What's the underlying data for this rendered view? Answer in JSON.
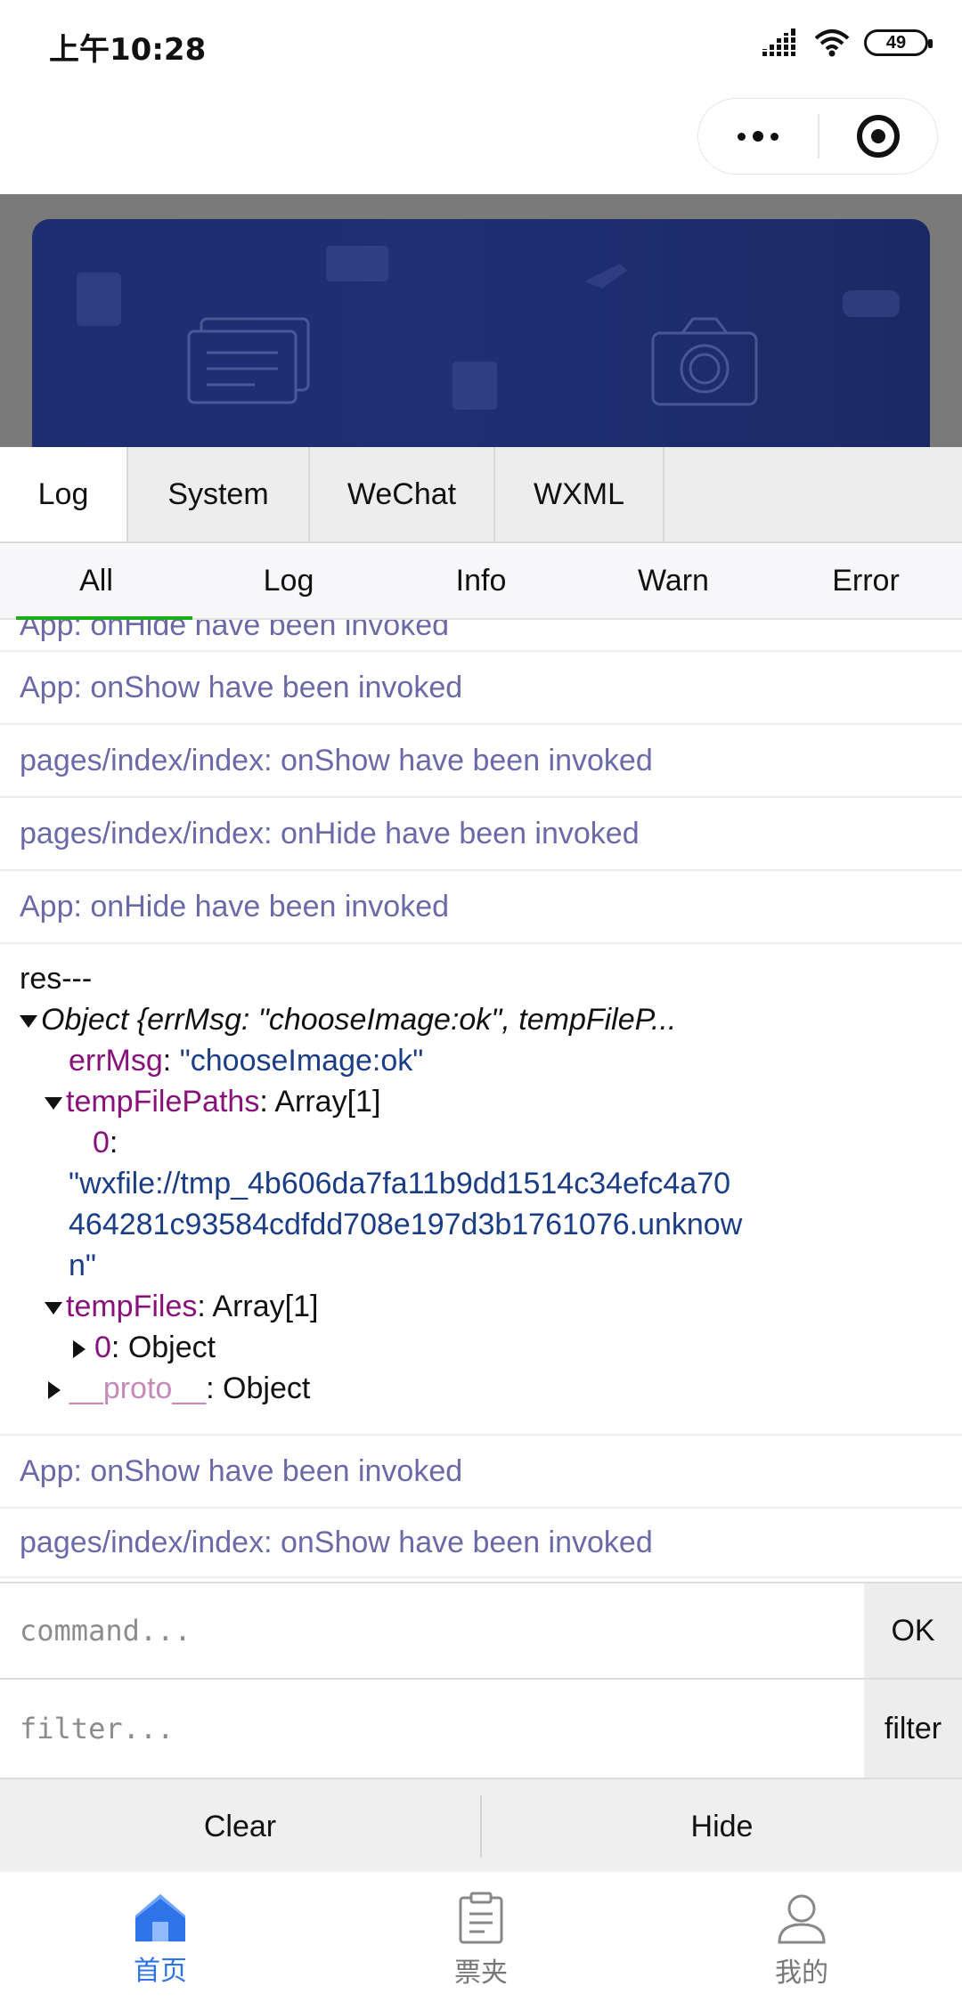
{
  "status_bar": {
    "time": "上午10:28",
    "battery": "49"
  },
  "console": {
    "tabs": [
      {
        "label": "Log",
        "active": true
      },
      {
        "label": "System",
        "active": false
      },
      {
        "label": "WeChat",
        "active": false
      },
      {
        "label": "WXML",
        "active": false
      }
    ],
    "filters": [
      {
        "label": "All",
        "active": true
      },
      {
        "label": "Log",
        "active": false
      },
      {
        "label": "Info",
        "active": false
      },
      {
        "label": "Warn",
        "active": false
      },
      {
        "label": "Error",
        "active": false
      }
    ],
    "logs": {
      "partial": "App: onHide have been invoked",
      "l1": "App: onShow have been invoked",
      "l2": "pages/index/index: onShow have been invoked",
      "l3": "pages/index/index: onHide have been invoked",
      "l4": "App: onHide have been invoked",
      "l5": "App: onShow have been invoked",
      "l6": "pages/index/index: onShow have been invoked"
    },
    "object_log": {
      "prefix": "res---",
      "summary": "Object {errMsg: \"chooseImage:ok\", tempFileP...",
      "errMsg_key": "errMsg",
      "errMsg_value": "\"chooseImage:ok\"",
      "tempFilePaths_key": "tempFilePaths",
      "tempFilePaths_type": "Array[1]",
      "index_key": "0",
      "path_line1": "\"wxfile://tmp_4b606da7fa11b9dd1514c34efc4a70",
      "path_line2": "464281c93584cdfdd708e197d3b1761076.unknow",
      "path_line3": "n\"",
      "tempFiles_key": "tempFiles",
      "tempFiles_type": "Array[1]",
      "tempFiles_item_key": "0",
      "tempFiles_item_type": "Object",
      "proto_key": "__proto__",
      "proto_type": "Object"
    },
    "command": {
      "placeholder": "command...",
      "button": "OK"
    },
    "filter": {
      "placeholder": "filter...",
      "button": "filter"
    },
    "clear_label": "Clear",
    "hide_label": "Hide"
  },
  "tabbar": [
    {
      "label": "首页",
      "icon": "home-icon",
      "active": true
    },
    {
      "label": "票夹",
      "icon": "clipboard-icon",
      "active": false
    },
    {
      "label": "我的",
      "icon": "user-icon",
      "active": false
    }
  ],
  "colors": {
    "accent": "#2f73e8",
    "log_text": "#6a6aa8",
    "key": "#881279",
    "banner": "#1e2f74",
    "active_filter": "#1aad19"
  }
}
